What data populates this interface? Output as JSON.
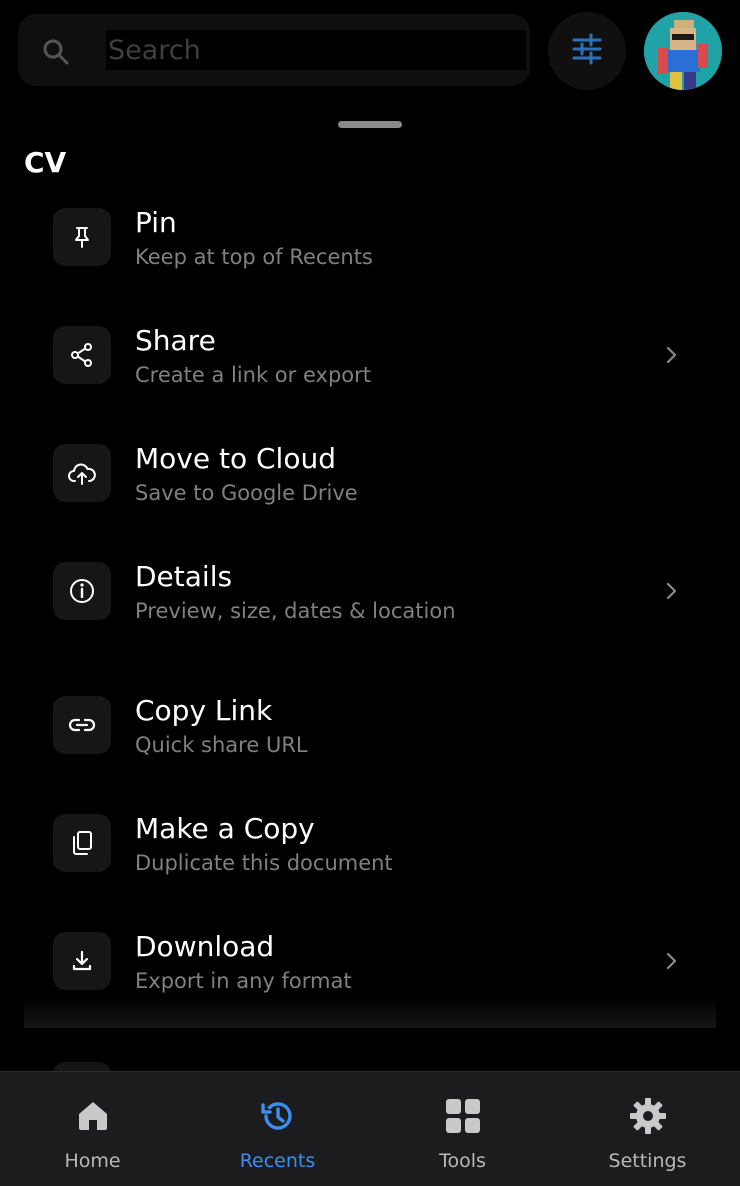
{
  "search": {
    "placeholder": "Search"
  },
  "sheet": {
    "title": "CV",
    "items": [
      {
        "label": "Pin",
        "subtitle": "Keep at top of Recents",
        "icon": "pin-icon",
        "has_chevron": false
      },
      {
        "label": "Share",
        "subtitle": "Create a link or export",
        "icon": "share-icon",
        "has_chevron": true
      },
      {
        "label": "Move to Cloud",
        "subtitle": "Save to Google Drive",
        "icon": "cloud-upload-icon",
        "has_chevron": false
      },
      {
        "label": "Details",
        "subtitle": "Preview, size, dates & location",
        "icon": "info-icon",
        "has_chevron": true
      },
      {
        "label": "Copy Link",
        "subtitle": "Quick share URL",
        "icon": "link-icon",
        "has_chevron": false
      },
      {
        "label": "Make a Copy",
        "subtitle": "Duplicate this document",
        "icon": "copy-icon",
        "has_chevron": false
      },
      {
        "label": "Download",
        "subtitle": "Export in any format",
        "icon": "download-icon",
        "has_chevron": true
      }
    ]
  },
  "bottom_nav": {
    "items": [
      {
        "label": "Home",
        "icon": "home-icon",
        "active": false
      },
      {
        "label": "Recents",
        "icon": "history-icon",
        "active": true
      },
      {
        "label": "Tools",
        "icon": "grid-icon",
        "active": false
      },
      {
        "label": "Settings",
        "icon": "gear-icon",
        "active": false
      }
    ]
  },
  "colors": {
    "background": "#000000",
    "accent": "#3d8ef0",
    "nav_background": "#1c1c1e",
    "subtitle_text": "#808080"
  }
}
